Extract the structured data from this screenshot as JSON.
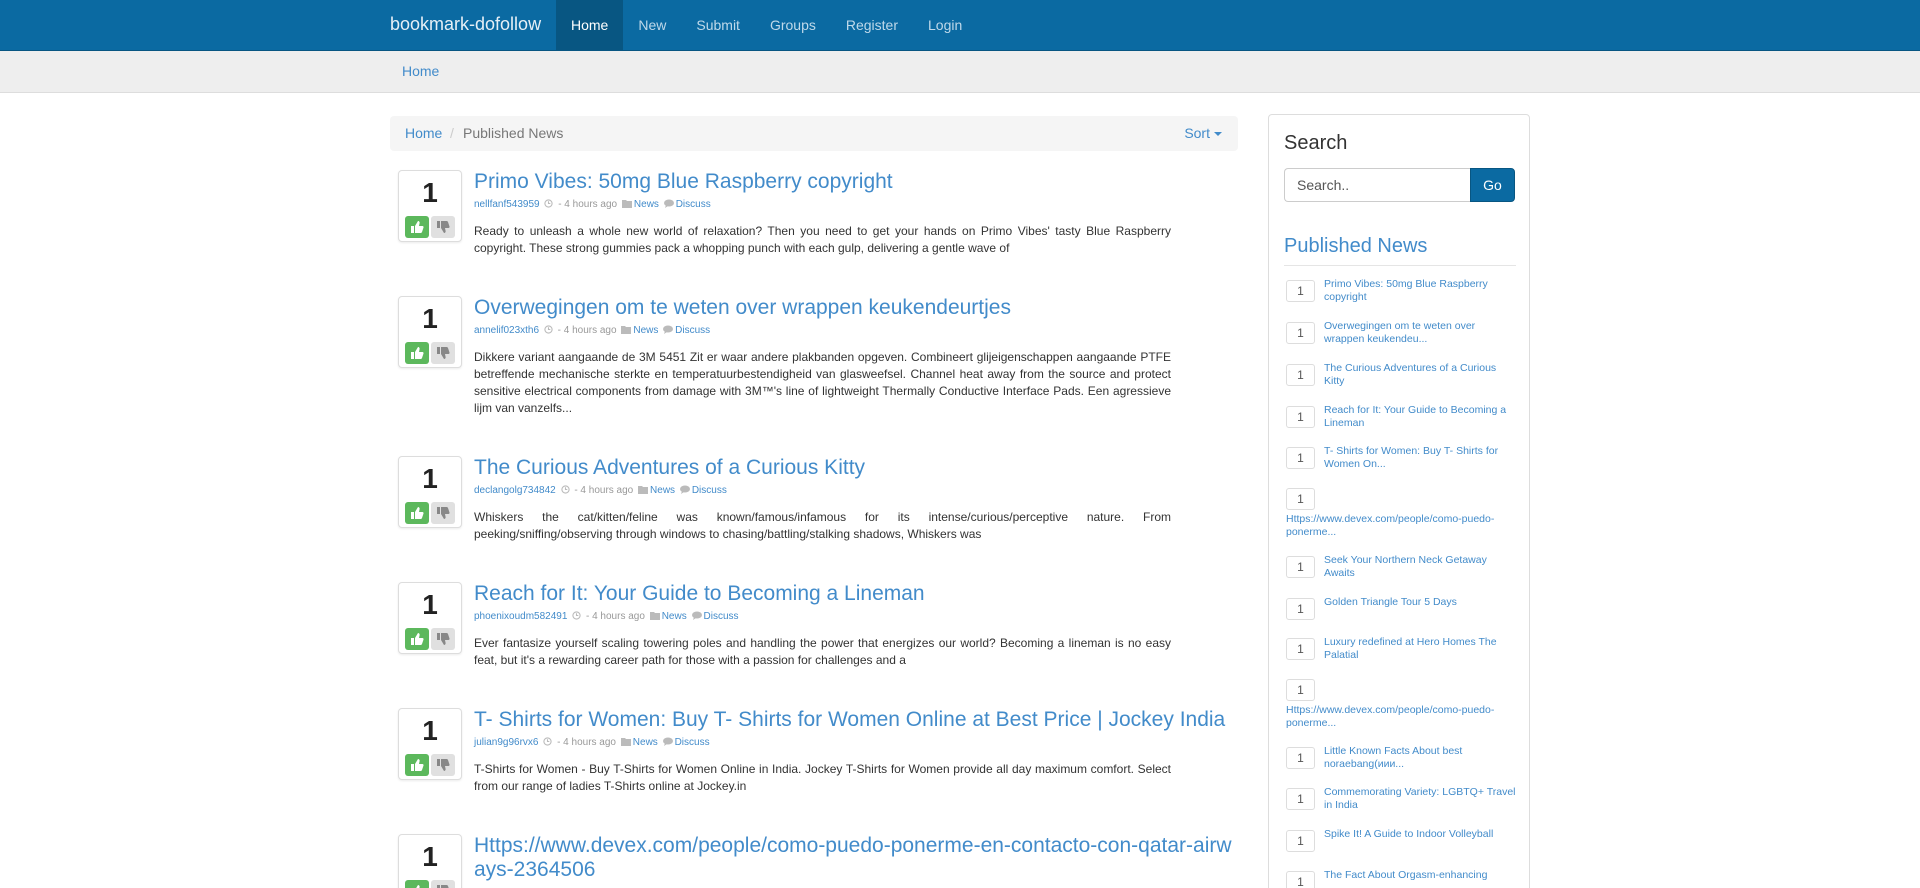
{
  "navbar": {
    "brand": "bookmark-dofollow",
    "items": [
      {
        "label": "Home",
        "active": true
      },
      {
        "label": "New"
      },
      {
        "label": "Submit"
      },
      {
        "label": "Groups"
      },
      {
        "label": "Register"
      },
      {
        "label": "Login"
      }
    ]
  },
  "subheader": {
    "home": "Home"
  },
  "breadcrumb": {
    "home": "Home",
    "separator": "/",
    "current": "Published News",
    "sort": "Sort"
  },
  "posts": [
    {
      "votes": "1",
      "title": "Primo Vibes: 50mg Blue Raspberry copyright",
      "user": "nellfanf543959",
      "time": "- 4 hours ago",
      "category": "News",
      "discuss": "Discuss",
      "desc": "Ready to unleash a whole new world of relaxation? Then you need to get your hands on Primo Vibes' tasty Blue Raspberry copyright. These strong gummies pack a whopping punch with each gulp, delivering a gentle wave of"
    },
    {
      "votes": "1",
      "title": "Overwegingen om te weten over wrappen keukendeurtjes",
      "user": "annelif023xth6",
      "time": "- 4 hours ago",
      "category": "News",
      "discuss": "Discuss",
      "desc": "Dikkere variant aangaande de 3M 5451 Zit er waar andere plakbanden opgeven. Combineert glijeigenschappen aangaande PTFE betreffende mechanische sterkte en temperatuurbestendigheid van glasweefsel. Channel heat away from the source and protect sensitive electrical components from damage with 3M™'s line of lightweight Thermally Conductive Interface Pads. Een agressieve lijm van vanzelfs..."
    },
    {
      "votes": "1",
      "title": "The Curious Adventures of a Curious Kitty",
      "user": "declangolg734842",
      "time": "- 4 hours ago",
      "category": "News",
      "discuss": "Discuss",
      "desc": "Whiskers the cat/kitten/feline was known/famous/infamous for its intense/curious/perceptive nature. From peeking/sniffing/observing through windows to chasing/battling/stalking shadows, Whiskers was"
    },
    {
      "votes": "1",
      "title": "Reach for It: Your Guide to Becoming a Lineman",
      "user": "phoenixoudm582491",
      "time": "- 4 hours ago",
      "category": "News",
      "discuss": "Discuss",
      "desc": "Ever fantasize yourself scaling towering poles and handling the power that energizes our world? Becoming a lineman is no easy feat, but it's a rewarding career path for those with a passion for challenges and a"
    },
    {
      "votes": "1",
      "title": "T- Shirts for Women: Buy T- Shirts for Women Online at Best Price | Jockey India",
      "user": "julian9g96rvx6",
      "time": "- 4 hours ago",
      "category": "News",
      "discuss": "Discuss",
      "desc": "T-Shirts for Women - Buy T-Shirts for Women Online in India. Jockey T-Shirts for Women provide all day maximum comfort. Select from our range of ladies T-Shirts online at Jockey.in"
    },
    {
      "votes": "1",
      "title": "Https://www.devex.com/people/como-puedo-ponerme-en-contacto-con-qatar-airways-2364506",
      "user": "",
      "time": "",
      "category": "",
      "discuss": "",
      "desc": ""
    }
  ],
  "sidebar": {
    "search_title": "Search",
    "search_placeholder": "Search..",
    "go": "Go",
    "published_title": "Published News",
    "items": [
      {
        "count": "1",
        "title": "Primo Vibes: 50mg Blue Raspberry copyright"
      },
      {
        "count": "1",
        "title": "Overwegingen om te weten over wrappen keukendeu..."
      },
      {
        "count": "1",
        "title": "The Curious Adventures of a Curious Kitty"
      },
      {
        "count": "1",
        "title": "Reach for It: Your Guide to Becoming a Lineman"
      },
      {
        "count": "1",
        "title": "T- Shirts for Women: Buy T- Shirts for Women On..."
      },
      {
        "count": "1",
        "title": "Https://www.devex.com/people/como-puedo-ponerme..."
      },
      {
        "count": "1",
        "title": "Seek Your Northern Neck Getaway Awaits"
      },
      {
        "count": "1",
        "title": "Golden Triangle Tour 5 Days"
      },
      {
        "count": "1",
        "title": "Luxury redefined at Hero Homes The Palatial"
      },
      {
        "count": "1",
        "title": "Https://www.devex.com/people/como-puedo-ponerme..."
      },
      {
        "count": "1",
        "title": "Little Known Facts About best noraebang(иии..."
      },
      {
        "count": "1",
        "title": "Commemorating Variety: LGBTQ+ Travel in India"
      },
      {
        "count": "1",
        "title": "Spike It! A Guide to Indoor Volleyball"
      },
      {
        "count": "1",
        "title": "The Fact About Orgasm-enhancing"
      }
    ]
  },
  "colors": {
    "navbar": "#0b6aa2",
    "link": "#428bca",
    "vote_up": "#5cb85c"
  }
}
